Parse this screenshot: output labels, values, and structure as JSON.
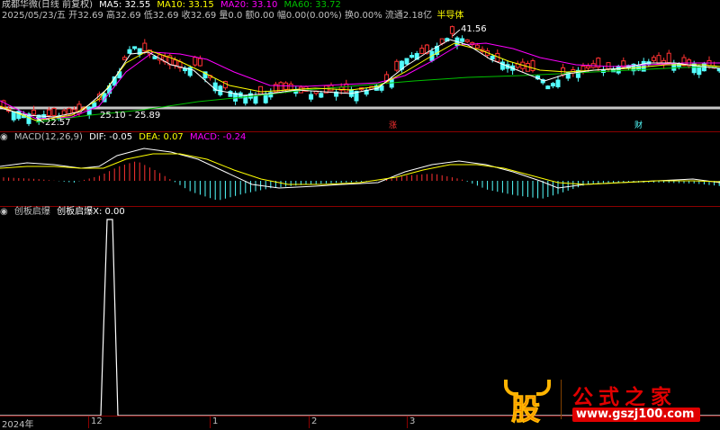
{
  "colors": {
    "ma5": "#ffffff",
    "ma10": "#ffff00",
    "ma20": "#ff00ff",
    "ma60": "#00c000",
    "up": "#ff3232",
    "down": "#54ffff",
    "divider": "#8b0000",
    "watermark_red": "#e00000",
    "watermark_gold": "#ffb400"
  },
  "main_panel": {
    "title": "成都华微(日线 前复权)",
    "ma5": "MA5: 32.55",
    "ma10": "MA10: 33.15",
    "ma20": "MA20: 33.10",
    "ma60": "MA60: 33.72",
    "quote": "2025/05/23/五 开32.69 高32.69 低32.69 收32.69 量0.0 额0.00 幅0.00(0.00%) 换0.00% 流通2.18亿",
    "industry": "半导体",
    "label_high": "41.56",
    "label_low": "22.57",
    "label_range": "25.10 - 25.89",
    "marker_zhang": "涨",
    "marker_cai": "财"
  },
  "macd_panel": {
    "name": "MACD(12,26,9)",
    "dif": "DIF: -0.05",
    "dea": "DEA: 0.07",
    "macd": "MACD: -0.24"
  },
  "indicator_panel": {
    "name": "创板启爆",
    "value": "创板启爆X: 0.00"
  },
  "time_axis": {
    "labels": [
      "2024年",
      "12",
      "1",
      "2",
      "3"
    ]
  },
  "watermark": {
    "logo_char": "股",
    "site_name": "公式之家",
    "url": "www.gszj100.com"
  }
}
